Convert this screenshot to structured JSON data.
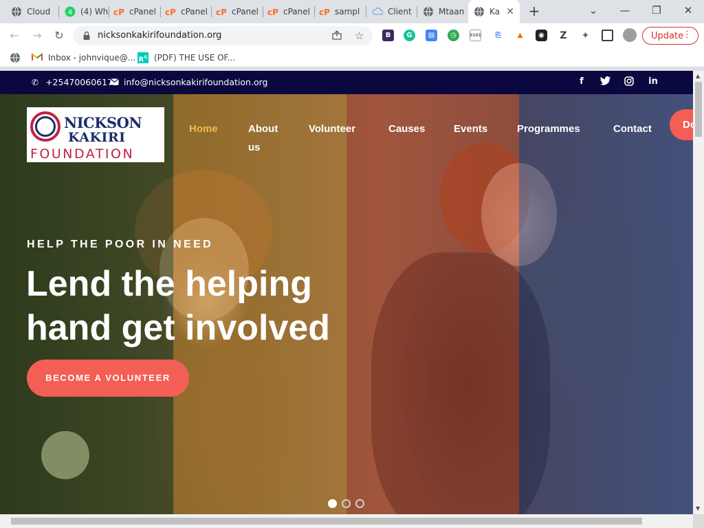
{
  "browser": {
    "tabs": [
      {
        "label": "Cloud",
        "icon": "globe-icon"
      },
      {
        "label": "(4) Wh",
        "icon": "whatsapp-icon",
        "badge_color": "#25d366"
      },
      {
        "label": "cPanel",
        "icon": "cpanel-icon"
      },
      {
        "label": "cPanel",
        "icon": "cpanel-icon"
      },
      {
        "label": "cPanel",
        "icon": "cpanel-icon"
      },
      {
        "label": "cPanel",
        "icon": "cpanel-icon"
      },
      {
        "label": "sampl",
        "icon": "cpanel-icon"
      },
      {
        "label": "Client",
        "icon": "cloud-icon"
      },
      {
        "label": "Mtaan",
        "icon": "globe-icon"
      },
      {
        "label": "Ka",
        "icon": "globe-icon",
        "active": true
      }
    ],
    "new_tab": "+",
    "window_controls": [
      "chevron-down-icon",
      "minimize-icon",
      "restore-icon",
      "close-icon"
    ],
    "url": "nicksonkakirifoundation.org",
    "update_label": "Update",
    "bookmarks": [
      {
        "label": "Inbox - johnvique@...",
        "icon": "gmail-icon"
      },
      {
        "label": "(PDF) THE USE OF...",
        "icon": "researchgate-icon"
      }
    ]
  },
  "site": {
    "topbar": {
      "phone": "+254700606171",
      "email": "info@nicksonkakirifoundation.org",
      "background": "#0a083f"
    },
    "logo": {
      "line1": "NICKSON",
      "line2": "KAKIRI",
      "line3": "FOUNDATION"
    },
    "nav": {
      "home": "Home",
      "about": "About us",
      "volunteer": "Volunteer",
      "causes": "Causes",
      "events": "Events",
      "programmes": "Programmes",
      "contact": "Contact",
      "donate": "Donate"
    },
    "hero": {
      "kicker": "HELP THE POOR IN NEED",
      "headline_line1": "Lend the helping",
      "headline_line2": "hand get involved",
      "cta": "BECOME A VOLUNTEER",
      "slides": 3,
      "active_slide": 1
    },
    "colors": {
      "accent": "#f35e55",
      "nav_active": "#f3b94c",
      "brand_navy": "#1c2d6a",
      "brand_red": "#c0223e"
    }
  }
}
